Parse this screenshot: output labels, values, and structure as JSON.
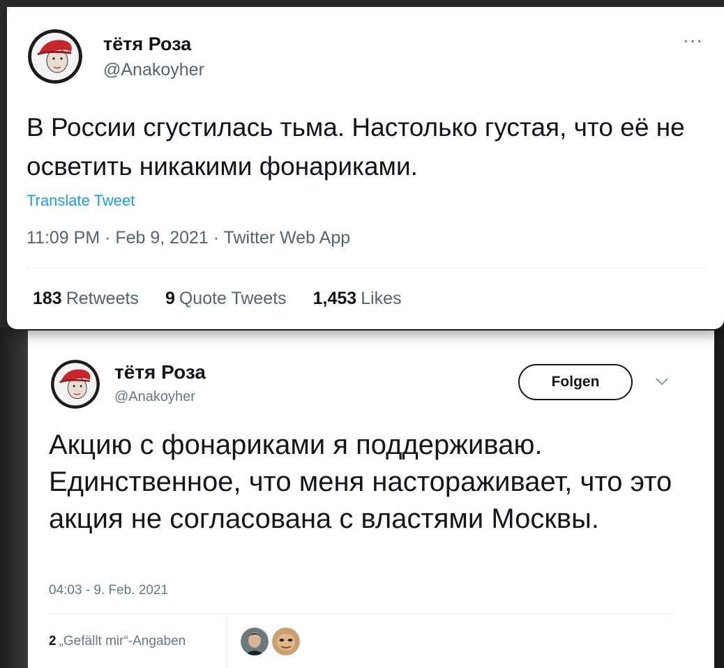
{
  "top_tweet": {
    "author_name": "тётя Роза",
    "author_handle": "@Anakoyher",
    "more_label": "···",
    "text": "В России сгустилась тьма. Настолько густая, что её не осветить никакими фонариками.",
    "translate_label": "Translate Tweet",
    "meta": "11:09 PM · Feb 9, 2021 · Twitter Web App",
    "stats": [
      {
        "count": "183",
        "label": "Retweets"
      },
      {
        "count": "9",
        "label": "Quote Tweets"
      },
      {
        "count": "1,453",
        "label": "Likes"
      }
    ]
  },
  "bottom_tweet": {
    "author_name": "тётя Роза",
    "author_handle": "@Anakoyher",
    "follow_label": "Folgen",
    "text": "Акцию с фонариками я поддерживаю. Единственное, что меня настораживает, что это акция не согласована с властями Москвы.",
    "meta": "04:03 - 9. Feb. 2021",
    "likes_count": "2",
    "likes_label": "„Gefällt mir“-Angaben"
  },
  "colors": {
    "accent": "#1d9bf0",
    "secondary_text": "#536471",
    "primary_text": "#0f1419"
  }
}
